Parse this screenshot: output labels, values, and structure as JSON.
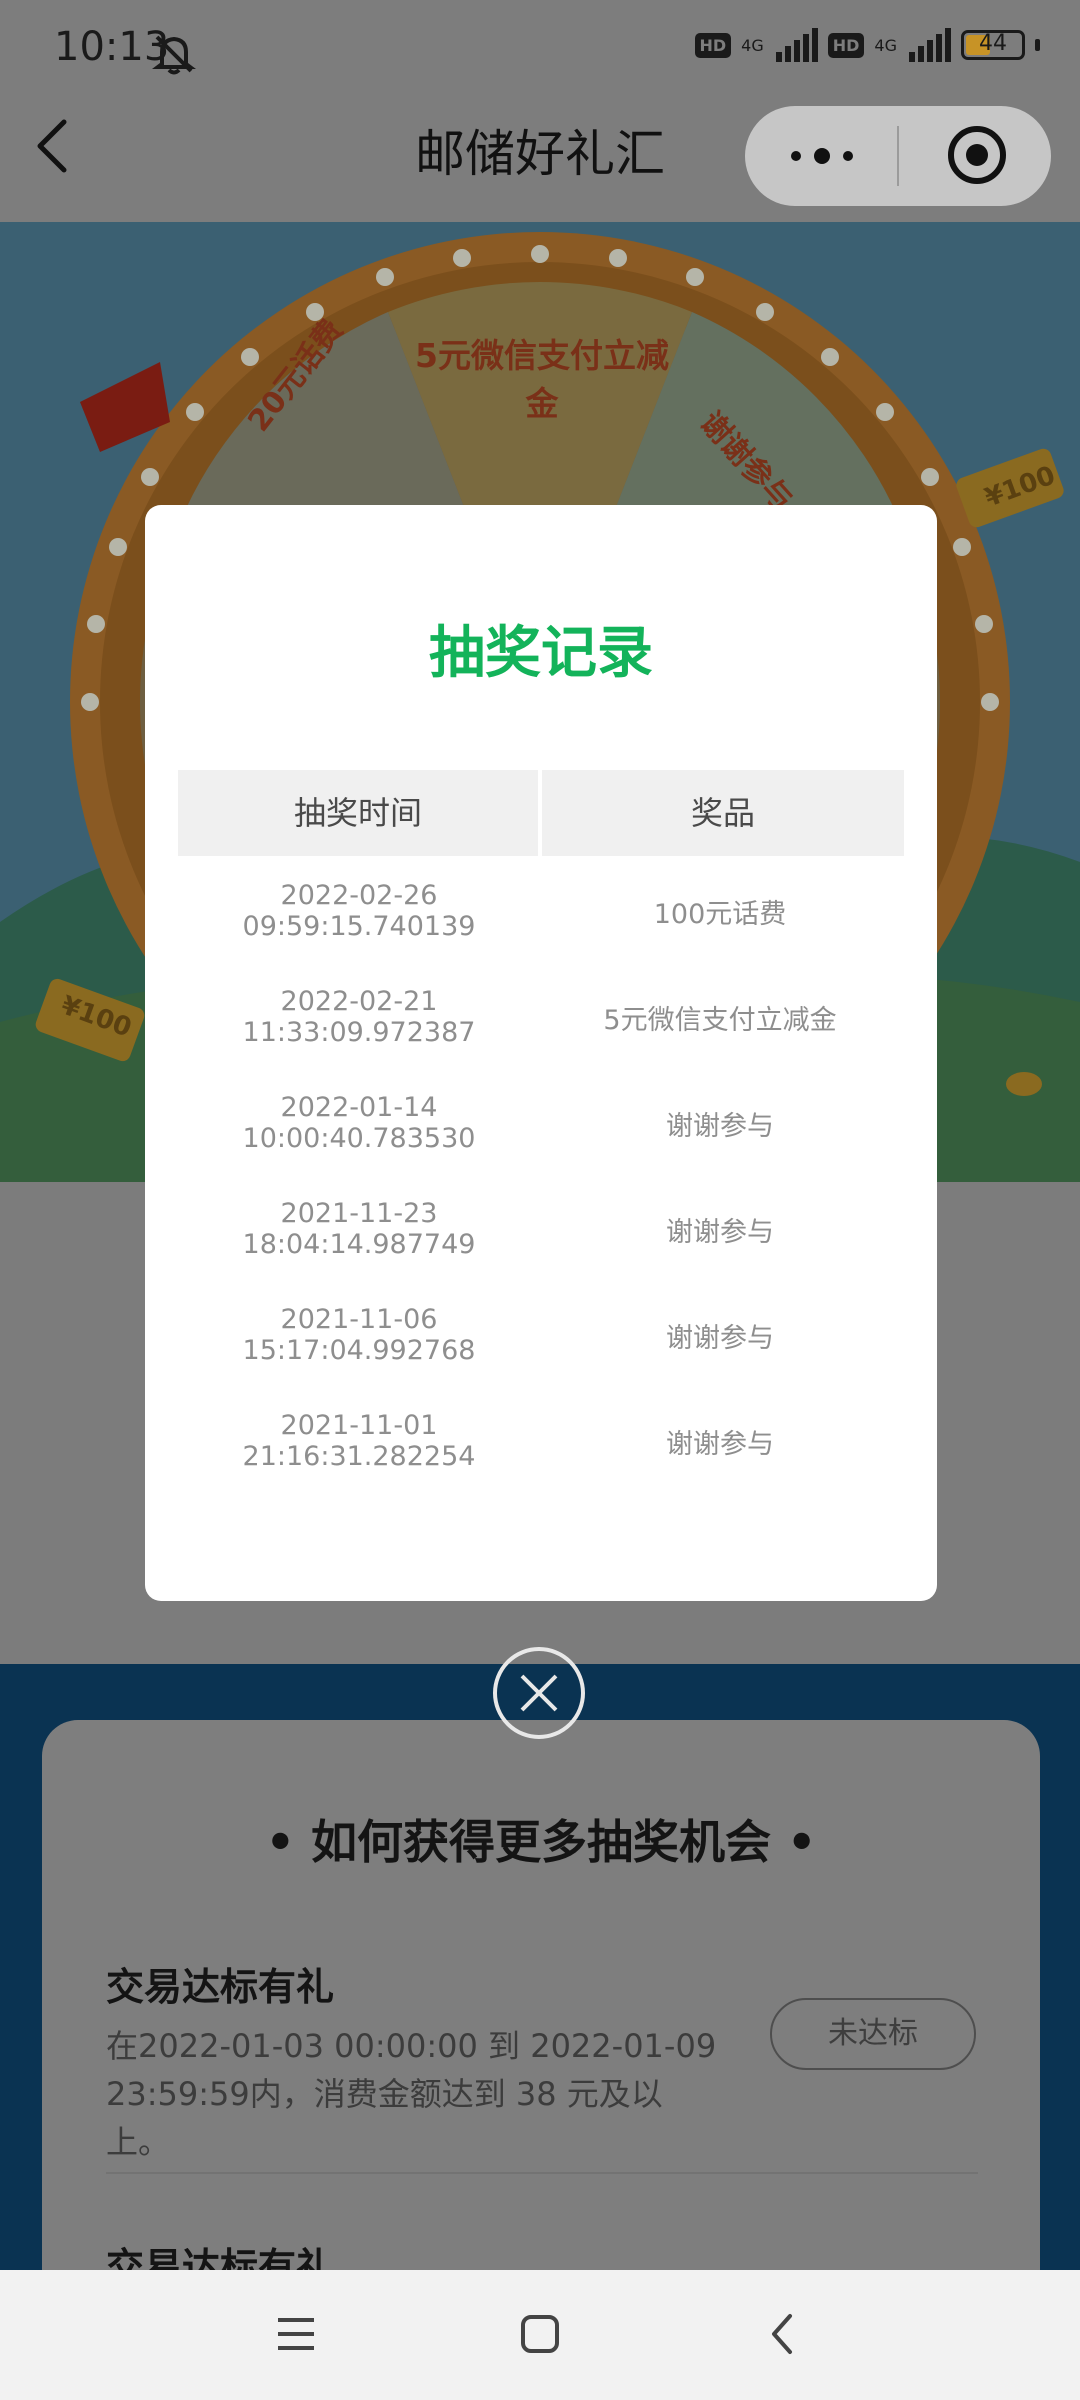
{
  "status_bar": {
    "time": "10:13",
    "network_1": "4G",
    "network_2": "4G",
    "hd_1": "HD",
    "hd_2": "HD",
    "battery": "44",
    "battery_level": 0.44
  },
  "nav": {
    "title": "邮储好礼汇"
  },
  "wheel": {
    "prize_top_line1": "5元微信支付立减",
    "prize_top_line2": "金",
    "prize_left": "20元话费",
    "prize_right": "谢谢参与",
    "coin_tag_right": "¥100",
    "coin_tag_left": "¥100"
  },
  "modal": {
    "title": "抽奖记录",
    "col_time": "抽奖时间",
    "col_prize": "奖品",
    "records": [
      {
        "time": "2022-02-26 09:59:15.740139",
        "prize": "100元话费"
      },
      {
        "time": "2022-02-21 11:33:09.972387",
        "prize": "5元微信支付立减金"
      },
      {
        "time": "2022-01-14 10:00:40.783530",
        "prize": "谢谢参与"
      },
      {
        "time": "2021-11-23 18:04:14.987749",
        "prize": "谢谢参与"
      },
      {
        "time": "2021-11-06 15:17:04.992768",
        "prize": "谢谢参与"
      },
      {
        "time": "2021-11-01 21:16:31.282254",
        "prize": "谢谢参与"
      }
    ]
  },
  "more_chances": {
    "heading": "• 如何获得更多抽奖机会 •",
    "task1_title": "交易达标有礼",
    "task1_desc": "在2022-01-03 00:00:00 到 2022-01-09 23:59:59内，消费金额达到 38 元及以上。",
    "task1_button": "未达标",
    "task2_title": "交易达标有礼"
  },
  "colors": {
    "accent_green": "#13b35a",
    "battery": "#c79326"
  },
  "icons": {
    "mute": "bell-off-icon",
    "back": "chevron-left-icon",
    "more": "more-dots-icon",
    "target": "target-icon",
    "close": "close-circle-icon",
    "menu": "menu-icon",
    "home": "home-square-icon",
    "sys_back": "back-arrow-icon"
  }
}
